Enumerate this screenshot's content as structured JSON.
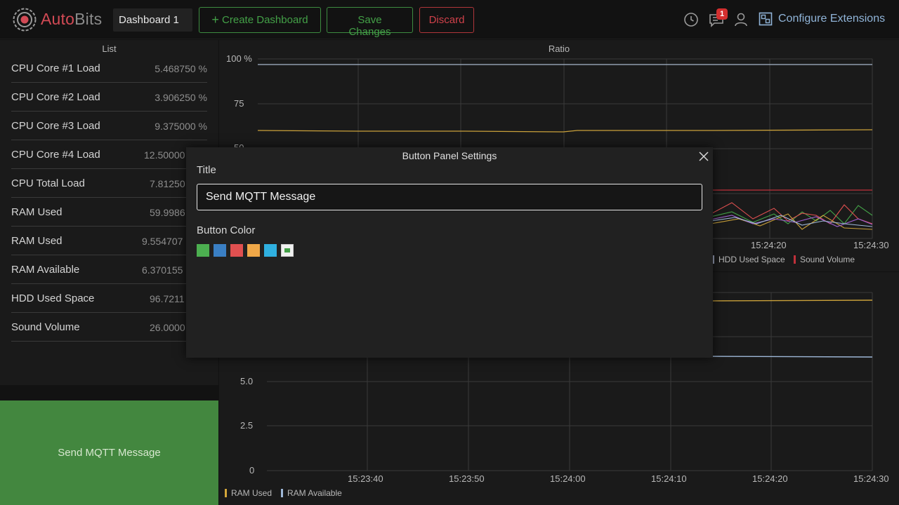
{
  "app": {
    "brand_auto": "Auto",
    "brand_bits": "Bits"
  },
  "toolbar": {
    "dashboard_name": "Dashboard 1",
    "create_label": "Create Dashboard",
    "save_label": "Save Changes",
    "discard_label": "Discard",
    "notifications_count": "1",
    "configure_label": "Configure Extensions"
  },
  "list_panel": {
    "title": "List",
    "items": [
      {
        "label": "CPU Core #1 Load",
        "value": "5.468750 %"
      },
      {
        "label": "CPU Core #2 Load",
        "value": "3.906250 %"
      },
      {
        "label": "CPU Core #3 Load",
        "value": "9.375000 %"
      },
      {
        "label": "CPU Core #4 Load",
        "value": "12.50000"
      },
      {
        "label": "CPU Total Load",
        "value": "7.81250"
      },
      {
        "label": "RAM Used",
        "value": "59.9986"
      },
      {
        "label": "RAM Used",
        "value": "9.554707"
      },
      {
        "label": "RAM Available",
        "value": "6.370155"
      },
      {
        "label": "HDD Used Space",
        "value": "96.7211"
      },
      {
        "label": "Sound Volume",
        "value": "26.0000"
      }
    ]
  },
  "button_panel": {
    "label": "Send MQTT Message"
  },
  "chart1": {
    "title": "Ratio",
    "y_ticks": [
      "100 %",
      "75",
      "50"
    ],
    "x_ticks": [
      "15:24:20",
      "15:24:30"
    ],
    "legend": [
      {
        "name": "HDD Used Space",
        "color": "#a0a8c0"
      },
      {
        "name": "Sound Volume",
        "color": "#c0303a"
      }
    ]
  },
  "chart2": {
    "y_ticks": [
      "5.0",
      "2.5",
      "0"
    ],
    "x_ticks": [
      "15:23:40",
      "15:23:50",
      "15:24:00",
      "15:24:10",
      "15:24:20",
      "15:24:30"
    ],
    "legend": [
      {
        "name": "RAM Used",
        "color": "#d4a63a"
      },
      {
        "name": "RAM Available",
        "color": "#9fb8d8"
      }
    ]
  },
  "modal": {
    "title": "Button Panel Settings",
    "title_label": "Title",
    "title_value": "Send MQTT Message",
    "color_label": "Button Color",
    "swatches": [
      "#4caf50",
      "#3a7fc4",
      "#e05050",
      "#f0a848",
      "#2fb0e0"
    ]
  },
  "colors": {
    "accent_green": "#43a047",
    "accent_red": "#d0414a",
    "accent_blue": "#90b4d8"
  }
}
